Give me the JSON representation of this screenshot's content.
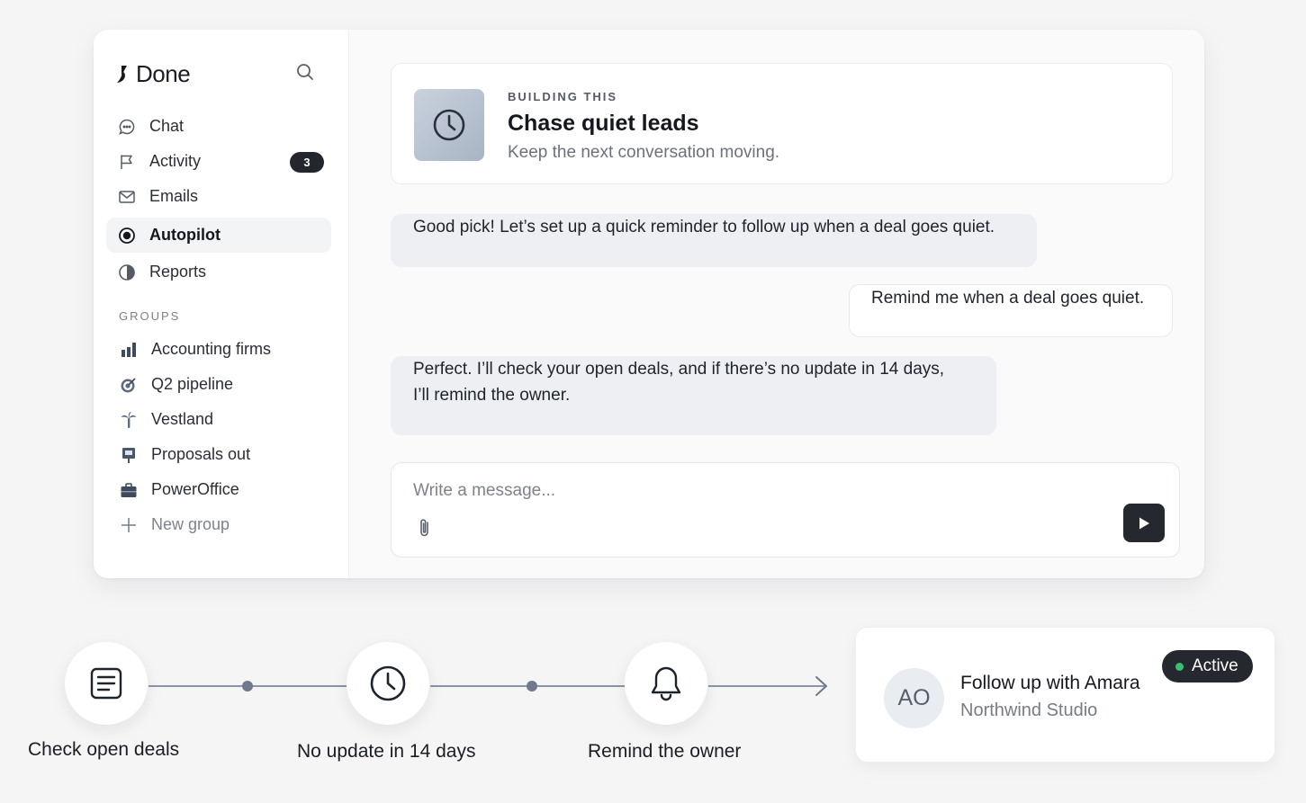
{
  "app": {
    "name": "Done"
  },
  "sidebar": {
    "nav": [
      {
        "label": "Chat",
        "icon": "chat-bubble-icon"
      },
      {
        "label": "Activity",
        "icon": "flag-icon",
        "badge": "3"
      },
      {
        "label": "Emails",
        "icon": "mail-icon"
      },
      {
        "label": "Autopilot",
        "icon": "target-icon",
        "active": true
      },
      {
        "label": "Reports",
        "icon": "pie-chart-icon"
      }
    ],
    "groups_title": "GROUPS",
    "groups": [
      {
        "label": "Accounting firms",
        "icon": "bar-chart-icon"
      },
      {
        "label": "Q2 pipeline",
        "icon": "bullseye-icon"
      },
      {
        "label": "Vestland",
        "icon": "palm-tree-icon"
      },
      {
        "label": "Proposals out",
        "icon": "presentation-icon"
      },
      {
        "label": "PowerOffice",
        "icon": "briefcase-icon"
      }
    ],
    "new_group": "New group"
  },
  "automation": {
    "eyebrow": "BUILDING THIS",
    "title": "Chase quiet leads",
    "subtitle": "Keep the next conversation moving."
  },
  "chat": {
    "messages": [
      {
        "from": "bot",
        "text": "Good pick! Let’s set up a quick reminder to follow up when a deal goes quiet."
      },
      {
        "from": "user",
        "text": "Remind me when a deal goes quiet."
      },
      {
        "from": "bot",
        "line1": "Perfect. I’ll check your open deals, and if there’s no update in 14 days,",
        "line2": "I’ll remind the owner."
      }
    ],
    "composer_placeholder": "Write a message..."
  },
  "flow": {
    "steps": [
      {
        "label": "Check open deals",
        "icon": "document-icon"
      },
      {
        "label": "No update in 14 days",
        "icon": "clock-icon"
      },
      {
        "label": "Remind the owner",
        "icon": "bell-icon"
      }
    ]
  },
  "task": {
    "initials": "AO",
    "title": "Follow up with Amara",
    "company": "Northwind Studio",
    "status": "Active",
    "status_color": "#38c172"
  }
}
